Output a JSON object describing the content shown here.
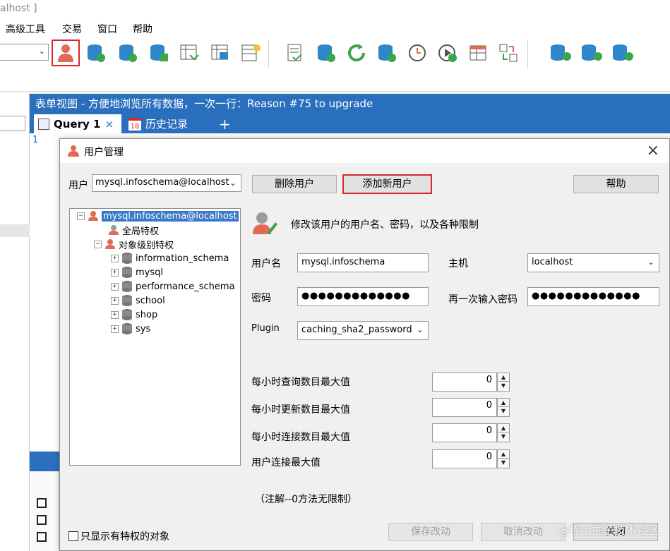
{
  "window": {
    "title": "alhost ]"
  },
  "menu": {
    "items": [
      "高级工具",
      "交易",
      "窗口",
      "帮助"
    ]
  },
  "main": {
    "header": "表单视图 - 方便地浏览所有数据，一次一行：Reason #75 to upgrade",
    "tabs": [
      {
        "label": "Query 1",
        "close": "×"
      },
      {
        "label": "历史记录",
        "badge": "18"
      }
    ],
    "add_tab": "+",
    "line_number": "1"
  },
  "dialog": {
    "title": "用户管理",
    "close": "×",
    "user_label": "用户",
    "user_selected": "mysql.infoschema@localhost",
    "buttons": {
      "delete_user": "删除用户",
      "add_user": "添加新用户",
      "help": "帮助",
      "save": "保存改动",
      "cancel": "取消改动",
      "close": "关闭"
    },
    "tree": {
      "root": "mysql.infoschema@localhost",
      "global_priv": "全局特权",
      "object_priv": "对象级别特权",
      "databases": [
        "information_schema",
        "mysql",
        "performance_schema",
        "school",
        "shop",
        "sys"
      ]
    },
    "description": "修改该用户的用户名、密码，以及各种限制",
    "form": {
      "username_label": "用户名",
      "username_value": "mysql.infoschema",
      "host_label": "主机",
      "host_value": "localhost",
      "password_label": "密码",
      "password_value": "●●●●●●●●●●●●●",
      "repeat_label": "再一次输入密码",
      "repeat_value": "●●●●●●●●●●●●●",
      "plugin_label": "Plugin",
      "plugin_value": "caching_sha2_password"
    },
    "limits": [
      {
        "label": "每小时查询数目最大值",
        "value": "0"
      },
      {
        "label": "每小时更新数目最大值",
        "value": "0"
      },
      {
        "label": "每小时连接数目最大值",
        "value": "0"
      },
      {
        "label": "用户连接最大值",
        "value": "0"
      }
    ],
    "note": "（注解--0方法无限制）",
    "only_priv_label": "只显示有特权的对象",
    "watermark": "@稀土掘金技术社区"
  },
  "colors": {
    "accent": "#2a6fbd",
    "highlight": "#d9262b",
    "tree_selected": "#3a78c8"
  }
}
